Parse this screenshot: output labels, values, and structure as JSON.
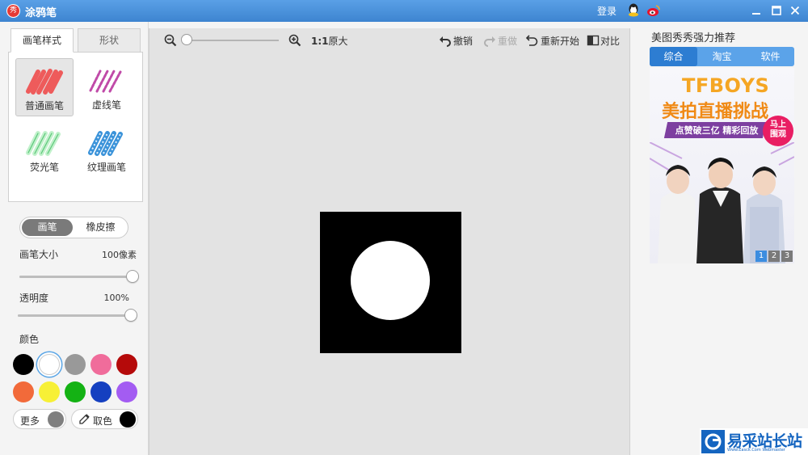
{
  "window": {
    "title": "涂鸦笔",
    "logo_char": "秀",
    "login_label": "登录",
    "accent_color": "#4a8fd6"
  },
  "left": {
    "tabs": [
      {
        "label": "画笔样式",
        "active": true
      },
      {
        "label": "形状",
        "active": false
      }
    ],
    "brushes": [
      {
        "label": "普通画笔",
        "icon": "normal-brush-icon",
        "selected": true
      },
      {
        "label": "虚线笔",
        "icon": "dashed-brush-icon",
        "selected": false
      },
      {
        "label": "荧光笔",
        "icon": "fluorescent-brush-icon",
        "selected": false
      },
      {
        "label": "纹理画笔",
        "icon": "texture-brush-icon",
        "selected": false
      }
    ],
    "mode": {
      "pen": "画笔",
      "eraser": "橡皮擦",
      "active": "pen"
    },
    "size": {
      "label": "画笔大小",
      "value_text": "100像素",
      "fraction": 1.0
    },
    "opacity": {
      "label": "透明度",
      "value_text": "100%",
      "fraction": 1.0
    },
    "color_label": "颜色",
    "colors": [
      "#000000",
      "#ffffff",
      "#999999",
      "#f06c9b",
      "#b50a0a",
      "#f26a3a",
      "#f7f036",
      "#14b214",
      "#1540c0",
      "#a35cf2"
    ],
    "selected_color_index": 1,
    "more_label": "更多",
    "more_color": "#7f7f7f",
    "pick_label": "取色",
    "pick_color": "#000000"
  },
  "toolbar": {
    "zoom_fraction": 0.0,
    "ratio": "1:1",
    "original": "原大",
    "undo": "撤销",
    "redo": "重做",
    "restart": "重新开始",
    "compare": "对比"
  },
  "right": {
    "title": "美图秀秀强力推荐",
    "tabs": [
      "综合",
      "淘宝",
      "软件"
    ],
    "active_tab": 0,
    "ad": {
      "title1": "TFBOYS",
      "title2": "美拍直播挑战",
      "banner": "点赞破三亿 精彩回放",
      "badge_line1": "马上",
      "badge_line2": "围观"
    },
    "pager": [
      "1",
      "2",
      "3"
    ],
    "active_page": 0
  },
  "watermark": {
    "text": "易采站长站",
    "sub": "Www.Easck.Com Webmaster"
  }
}
